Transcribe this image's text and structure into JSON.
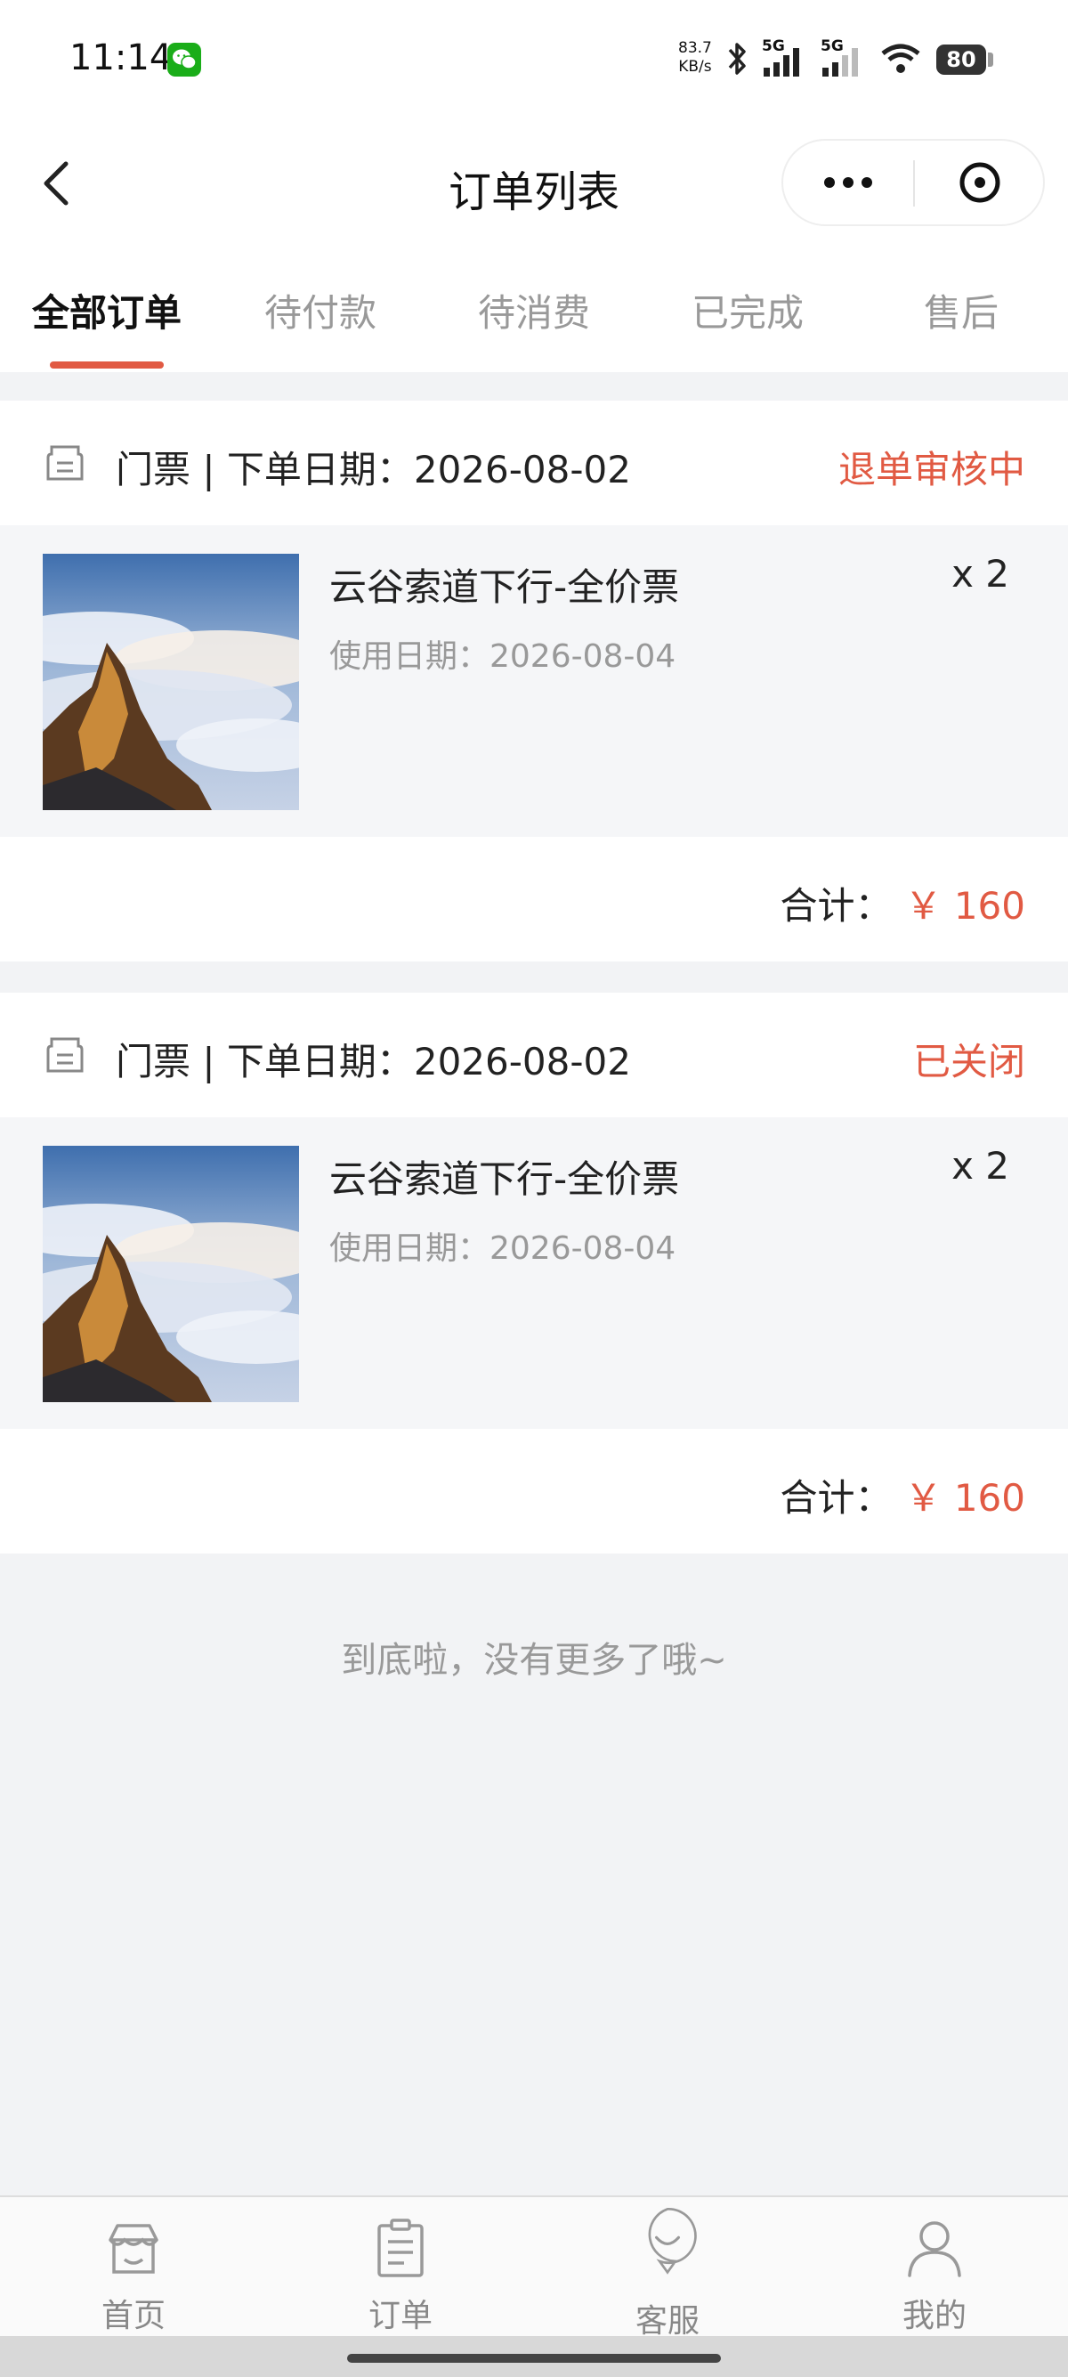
{
  "status_bar": {
    "time": "11:14",
    "net_speed_value": "83.7",
    "net_speed_unit": "KB/s",
    "signal_1": "5G",
    "signal_2": "5G",
    "battery": "80",
    "icons": [
      "wechat-icon",
      "bluetooth-icon",
      "signal-icon",
      "signal-icon",
      "wifi-icon",
      "battery-icon"
    ]
  },
  "nav": {
    "title": "订单列表",
    "back_icon": "chevron-left-icon",
    "more_icon": "more-icon",
    "close_icon": "close-circle-icon"
  },
  "tabs": [
    {
      "label": "全部订单",
      "active": true
    },
    {
      "label": "待付款",
      "active": false
    },
    {
      "label": "待消费",
      "active": false
    },
    {
      "label": "已完成",
      "active": false
    },
    {
      "label": "售后",
      "active": false
    }
  ],
  "orders": [
    {
      "meta": "门票 | 下单日期：2026-08-02",
      "status": "退单审核中",
      "product_name": "云谷索道下行-全价票",
      "use_date": "使用日期：2026-08-04",
      "qty": "x 2",
      "total_label": "合计：",
      "total_price": "￥ 160"
    },
    {
      "meta": "门票 | 下单日期：2026-08-02",
      "status": "已关闭",
      "product_name": "云谷索道下行-全价票",
      "use_date": "使用日期：2026-08-04",
      "qty": "x 2",
      "total_label": "合计：",
      "total_price": "￥ 160"
    }
  ],
  "end_note": "到底啦，没有更多了哦~",
  "bottom_nav": [
    {
      "label": "首页",
      "icon": "home-icon"
    },
    {
      "label": "订单",
      "icon": "order-icon"
    },
    {
      "label": "客服",
      "icon": "service-icon"
    },
    {
      "label": "我的",
      "icon": "user-icon"
    }
  ],
  "colors": {
    "accent": "#e15a43",
    "background": "#f2f3f5",
    "muted_text": "#999999"
  }
}
